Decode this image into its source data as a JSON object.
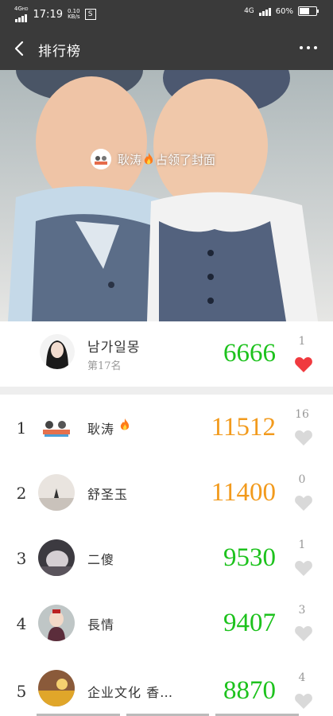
{
  "status": {
    "network": "4G",
    "net_sup": "HD",
    "time": "17:19",
    "speed_value": "0.10",
    "speed_unit": "KB/s",
    "s_badge": "S",
    "right_network": "4G",
    "battery": "60%"
  },
  "nav": {
    "title": "排行榜"
  },
  "banner": {
    "cover_user": "耿涛",
    "cover_text": "占领了封面"
  },
  "me": {
    "name": "남가일몽",
    "rank_text": "第17名",
    "score": "6666",
    "likes": "1"
  },
  "colors": {
    "green": "#1dc21d",
    "orange": "#f29a1c",
    "heart_red": "#f03a3f",
    "heart_grey": "#d9d9d9"
  },
  "rows": [
    {
      "rank": "1",
      "name": "耿涛",
      "score": "11512",
      "likes": "16",
      "score_color": "orange",
      "has_fire": true
    },
    {
      "rank": "2",
      "name": "舒圣玉",
      "score": "11400",
      "likes": "0",
      "score_color": "orange"
    },
    {
      "rank": "3",
      "name": "二傻",
      "score": "9530",
      "likes": "1",
      "score_color": "green"
    },
    {
      "rank": "4",
      "name": "長情",
      "score": "9407",
      "likes": "3",
      "score_color": "green"
    },
    {
      "rank": "5",
      "name": "企业文化 香…",
      "score": "8870",
      "likes": "4",
      "score_color": "green"
    }
  ]
}
